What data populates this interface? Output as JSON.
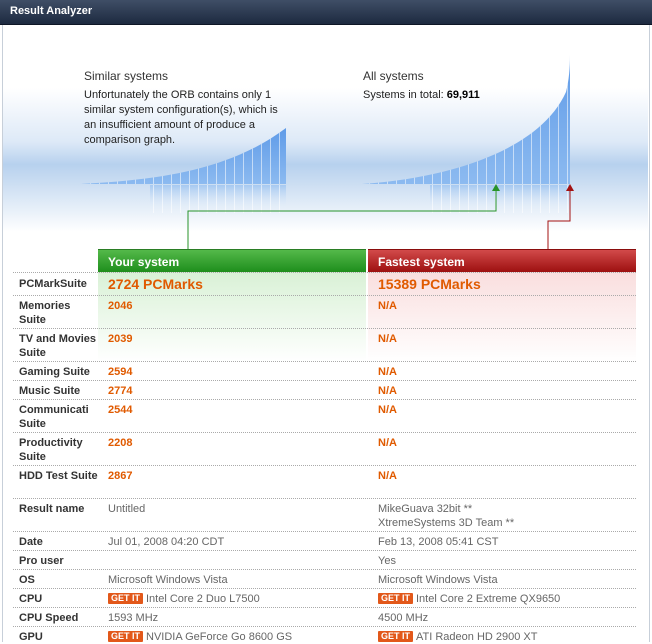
{
  "window": {
    "title": "Result Analyzer"
  },
  "similar": {
    "title": "Similar systems",
    "text_lines": [
      "Unfortunately the ORB contains only 1",
      "similar system configuration(s), which is",
      "an insufficient amount of produce a",
      "comparison graph."
    ]
  },
  "all": {
    "title": "All systems",
    "total_label": "Systems in total:",
    "total_value": "69,911"
  },
  "columns": {
    "yours": "Your system",
    "fastest": "Fastest system"
  },
  "rows": [
    {
      "label": "PCMarkSuite",
      "yours": "2724 PCMarks",
      "fastest": "15389 PCMarks"
    },
    {
      "label": "Memories Suite",
      "yours": "2046",
      "fastest": "N/A"
    },
    {
      "label": "TV and Movies Suite",
      "yours": "2039",
      "fastest": "N/A"
    },
    {
      "label": "Gaming Suite",
      "yours": "2594",
      "fastest": "N/A"
    },
    {
      "label": "Music Suite",
      "yours": "2774",
      "fastest": "N/A"
    },
    {
      "label": "Communicati Suite",
      "yours": "2544",
      "fastest": "N/A"
    },
    {
      "label": "Productivity Suite",
      "yours": "2208",
      "fastest": "N/A"
    },
    {
      "label": "HDD Test Suite",
      "yours": "2867",
      "fastest": "N/A"
    },
    {
      "label": "Result name",
      "yours": "Untitled",
      "fastest": "MikeGuava 32bit **",
      "fastest2": "XtremeSystems 3D Team **"
    },
    {
      "label": "Date",
      "yours": "Jul 01, 2008 04:20 CDT",
      "fastest": "Feb 13, 2008 05:41 CST"
    },
    {
      "label": "Pro user",
      "yours": "",
      "fastest": "Yes"
    },
    {
      "label": "OS",
      "yours": "Microsoft Windows Vista",
      "fastest": "Microsoft Windows Vista"
    },
    {
      "label": "CPU",
      "yours": "Intel Core 2 Duo L7500",
      "fastest": "Intel Core 2 Extreme QX9650"
    },
    {
      "label": "CPU Speed",
      "yours": "1593 MHz",
      "fastest": "4500 MHz"
    },
    {
      "label": "GPU",
      "yours": "NVIDIA GeForce Go 8600 GS",
      "fastest": "ATI Radeon HD 2900 XT"
    }
  ],
  "getit_label": "GET IT",
  "colors": {
    "accent_green": "#1e8e1c",
    "accent_red": "#9d1010",
    "score_orange": "#e05a00"
  }
}
